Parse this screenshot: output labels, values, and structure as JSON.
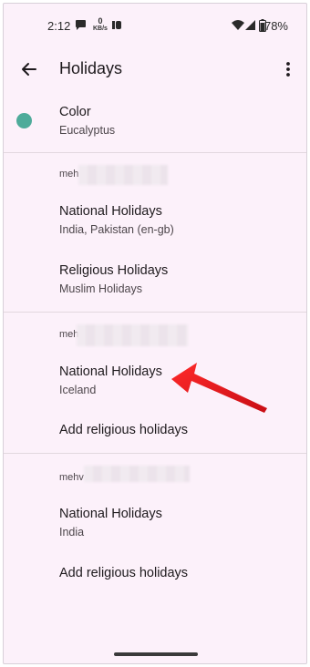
{
  "status_bar": {
    "time": "2:12",
    "kbs_top": "0",
    "kbs_bottom": "KB/s",
    "battery_percent": "78%"
  },
  "app_bar": {
    "title": "Holidays",
    "back_icon": "arrow-back-icon",
    "more_icon": "more-vert-icon"
  },
  "color_setting": {
    "title": "Color",
    "value": "Eucalyptus",
    "swatch": "#4eab9a"
  },
  "accounts": [
    {
      "label_visible": "meh",
      "items": [
        {
          "title": "National Holidays",
          "subtitle": "India, Pakistan (en-gb)"
        },
        {
          "title": "Religious Holidays",
          "subtitle": "Muslim Holidays"
        }
      ]
    },
    {
      "label_visible": "meh",
      "items": [
        {
          "title": "National Holidays",
          "subtitle": "Iceland"
        },
        {
          "title": "Add religious holidays",
          "subtitle": ""
        }
      ]
    },
    {
      "label_visible": "mehv",
      "items": [
        {
          "title": "National Holidays",
          "subtitle": "India"
        },
        {
          "title": "Add religious holidays",
          "subtitle": ""
        }
      ]
    }
  ],
  "annotation": {
    "arrow_color": "#e8161c"
  }
}
